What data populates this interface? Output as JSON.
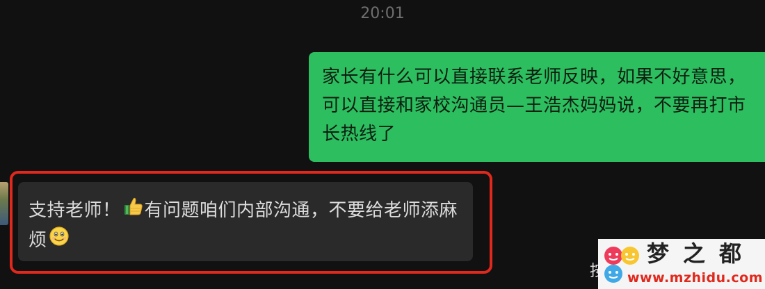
{
  "chat": {
    "timestamp": "20:01",
    "messages": [
      {
        "direction": "outgoing",
        "text": "家长有什么可以直接联系老师反映，如果不好意思，可以直接和家校沟通员—王浩杰妈妈说，不要再打市长热线了",
        "bubble_color": "#2dbe60"
      },
      {
        "direction": "incoming",
        "text_part1": "支持老师！",
        "emoji1": "thumbs-up-icon",
        "text_part2": "有问题咱们内部沟通，不要给老师添麻烦",
        "emoji2": "smile-icon",
        "bubble_color": "#2a2a2a",
        "highlight_color": "#e0281c"
      }
    ],
    "partial_text": "按"
  },
  "watermark": {
    "title": "梦之都",
    "url": "www.mzhidu.com"
  },
  "colors": {
    "background": "#111111",
    "accent_red": "#e0281c"
  }
}
